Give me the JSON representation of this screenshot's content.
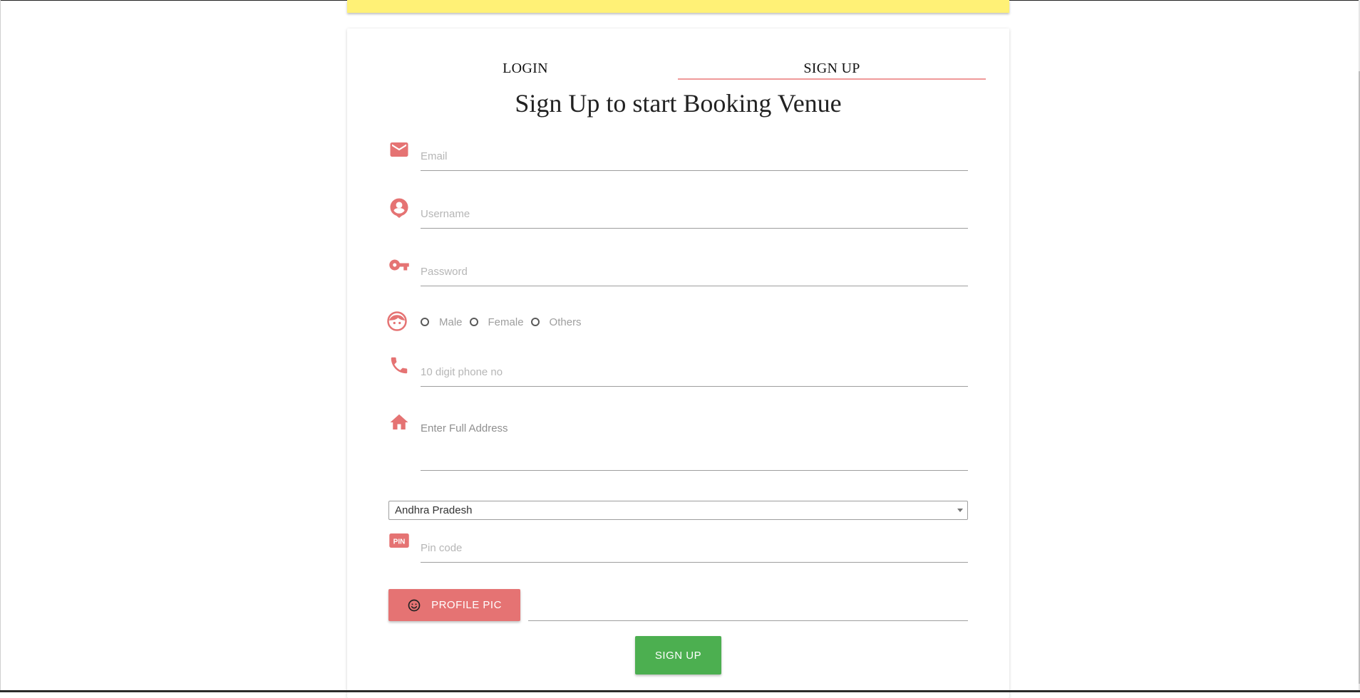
{
  "tabs": {
    "login": "LOGIN",
    "signup": "SIGN UP",
    "active": "signup"
  },
  "form": {
    "heading": "Sign Up to start Booking Venue",
    "email": {
      "placeholder": "Email",
      "value": ""
    },
    "username": {
      "placeholder": "Username",
      "value": ""
    },
    "password": {
      "placeholder": "Password",
      "value": ""
    },
    "gender": {
      "options": [
        "Male",
        "Female",
        "Others"
      ],
      "selected": null
    },
    "phone": {
      "placeholder": "10 digit phone no",
      "value": ""
    },
    "address": {
      "placeholder": "Enter Full Address",
      "value": ""
    },
    "state": {
      "selected": "Andhra Pradesh"
    },
    "pincode": {
      "placeholder": "Pin code",
      "value": ""
    },
    "profile_pic_label": "PROFILE PIC",
    "submit_label": "SIGN UP"
  },
  "icons": {
    "email": "email-icon",
    "username": "account-circle-icon",
    "password": "key-icon",
    "gender": "face-icon",
    "phone": "phone-icon",
    "address": "home-icon",
    "pincode": "pin-icon",
    "profile_pic": "smiley-icon",
    "pin_badge": "PIN"
  },
  "colors": {
    "accent": "#e57373",
    "tab_underline": "#ef9a9a",
    "header_bar": "#fff176",
    "submit": "#4caf50"
  }
}
